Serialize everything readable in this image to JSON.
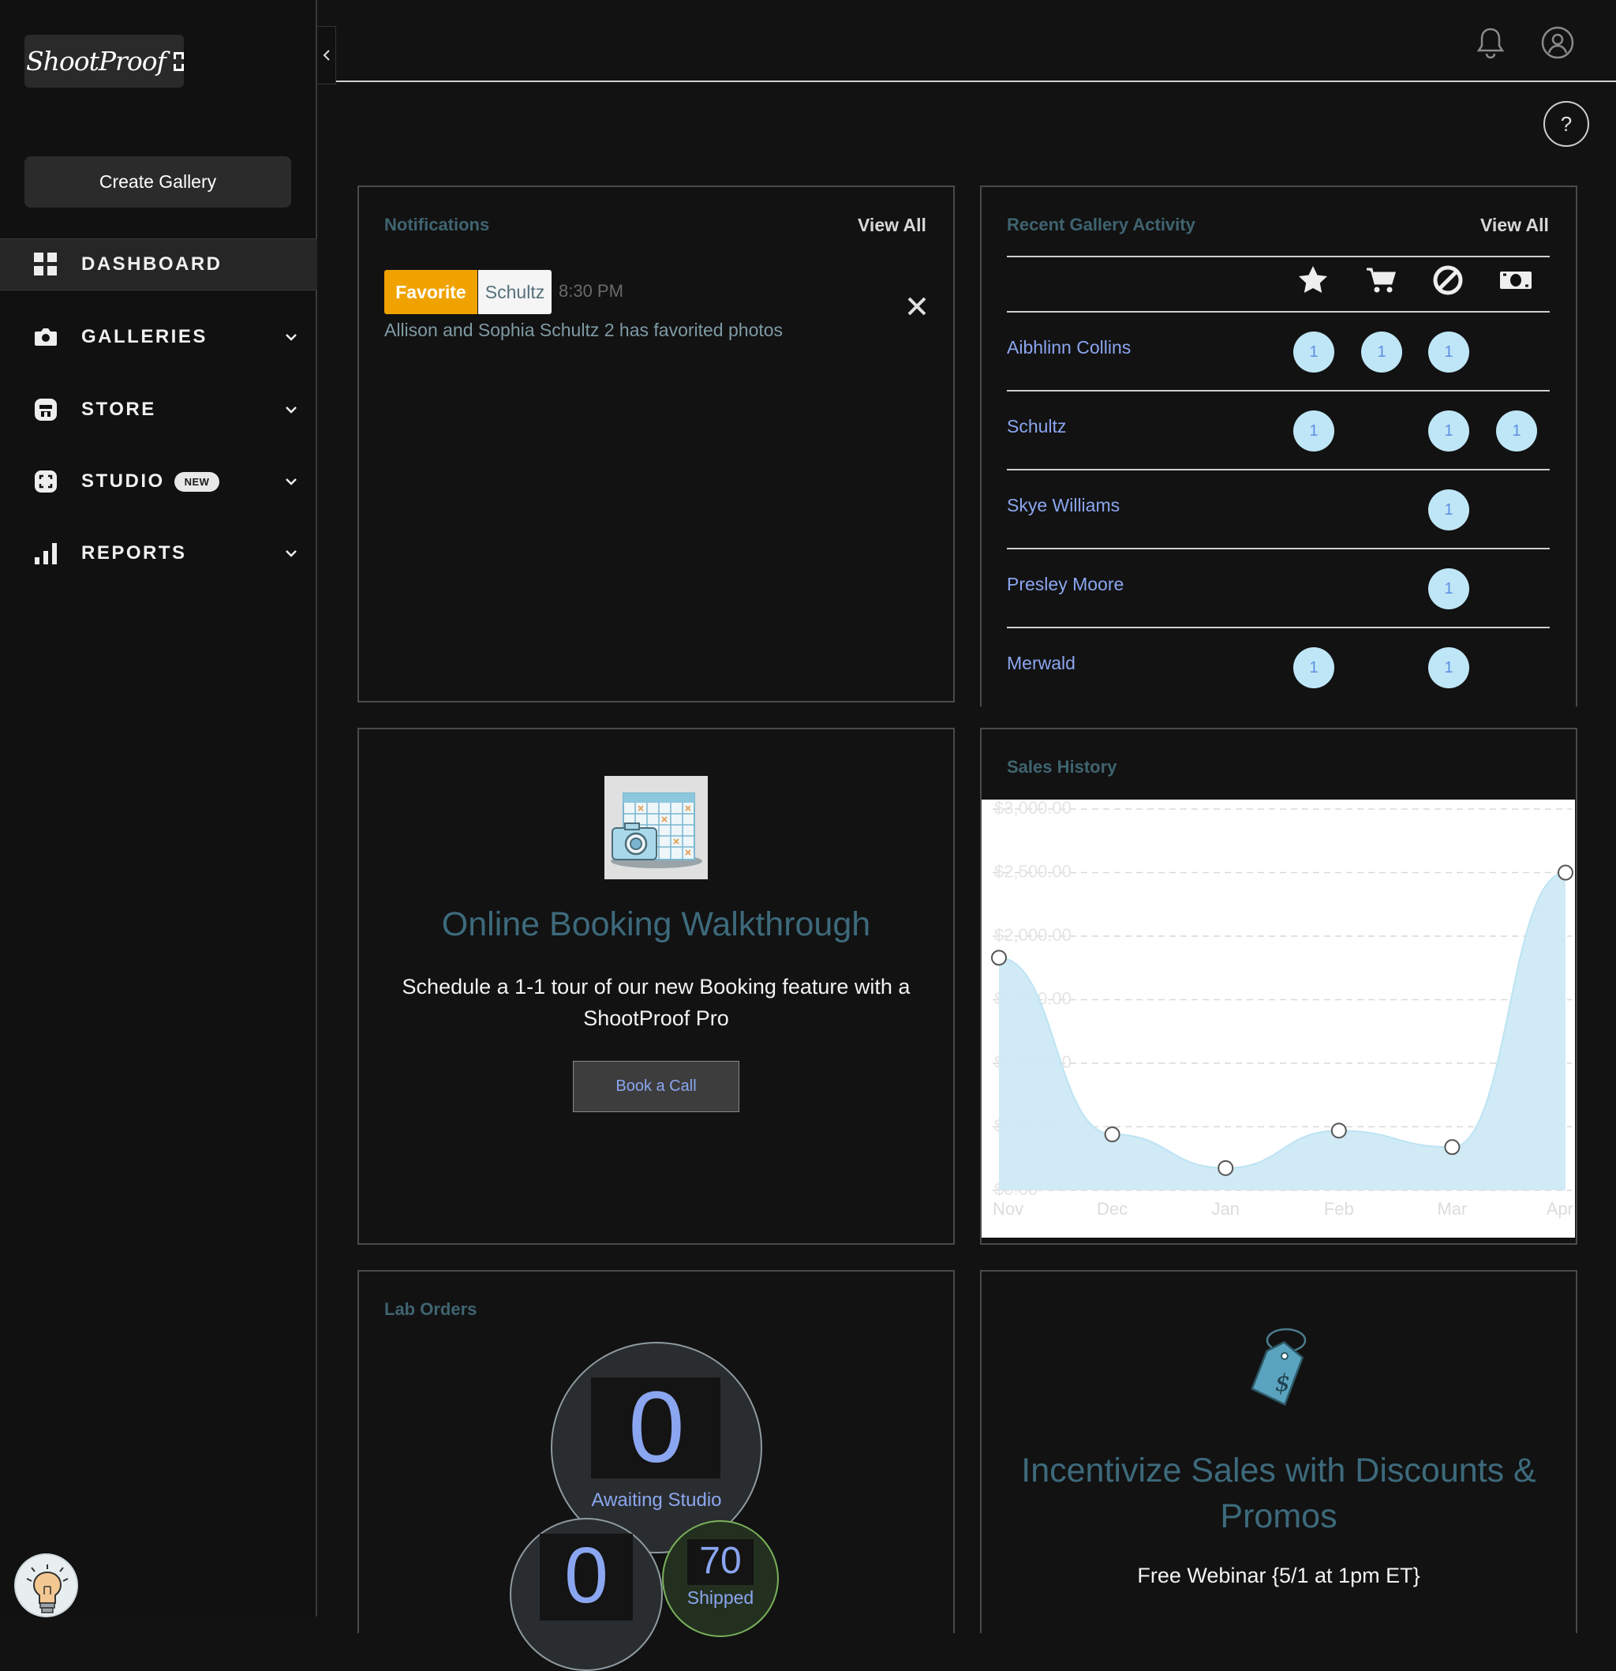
{
  "brand": {
    "logo_text": "ShootProof"
  },
  "sidebar": {
    "create_label": "Create Gallery",
    "items": [
      {
        "label": "DASHBOARD",
        "icon": "dashboard-grid-icon",
        "active": true
      },
      {
        "label": "GALLERIES",
        "icon": "camera-icon"
      },
      {
        "label": "STORE",
        "icon": "store-icon"
      },
      {
        "label": "STUDIO",
        "icon": "studio-focus-icon",
        "badge": "NEW"
      },
      {
        "label": "REPORTS",
        "icon": "bar-chart-icon"
      }
    ]
  },
  "topbar": {
    "help_label": "?"
  },
  "notifications": {
    "title": "Notifications",
    "view_all": "View All",
    "items": [
      {
        "tag": "Favorite",
        "name": "Schultz",
        "time": "8:30 PM",
        "message": "Allison and Sophia Schultz 2 has favorited photos"
      }
    ]
  },
  "recent_activity": {
    "title": "Recent Gallery Activity",
    "view_all": "View All",
    "columns": [
      "star-icon",
      "cart-icon",
      "blocked-icon",
      "cash-icon"
    ],
    "rows": [
      {
        "name": "Aibhlinn Collins",
        "counts": [
          "1",
          "1",
          "1",
          ""
        ]
      },
      {
        "name": "Schultz",
        "counts": [
          "1",
          "",
          "1",
          "1"
        ]
      },
      {
        "name": "Skye Williams",
        "counts": [
          "",
          "",
          "1",
          ""
        ]
      },
      {
        "name": "Presley Moore",
        "counts": [
          "",
          "",
          "1",
          ""
        ]
      },
      {
        "name": "Merwald",
        "counts": [
          "1",
          "",
          "1",
          ""
        ]
      }
    ]
  },
  "booking": {
    "title": "Online Booking Walkthrough",
    "text_line1": "Schedule a 1-1 tour of our new Booking feature with a",
    "text_line2": "ShootProof Pro",
    "button": "Book a Call"
  },
  "chart_data": {
    "type": "area",
    "title": "Sales History",
    "categories": [
      "Nov",
      "Dec",
      "Jan",
      "Feb",
      "Mar",
      "Apr"
    ],
    "values": [
      1830,
      440,
      175,
      470,
      340,
      2500
    ],
    "y_ticks": [
      "$0.00",
      "$500.00",
      "$1,000.00",
      "$1,500.00",
      "$2,000.00",
      "$2,500.00",
      "$3,000.00"
    ],
    "ylim": [
      0,
      3000
    ],
    "grid": true,
    "colors": {
      "fill": "#cdeaf6",
      "line": "#bde3f3",
      "point": "#ffffff"
    }
  },
  "lab_orders": {
    "title": "Lab Orders",
    "awaiting_count": "0",
    "awaiting_label": "Awaiting Studio",
    "second_count": "0",
    "shipped_count": "70",
    "shipped_label": "Shipped"
  },
  "promo": {
    "title_line1": "Incentivize Sales with Discounts &",
    "title_line2": "Promos",
    "subtitle": "Free Webinar {5/1 at 1pm ET}"
  }
}
